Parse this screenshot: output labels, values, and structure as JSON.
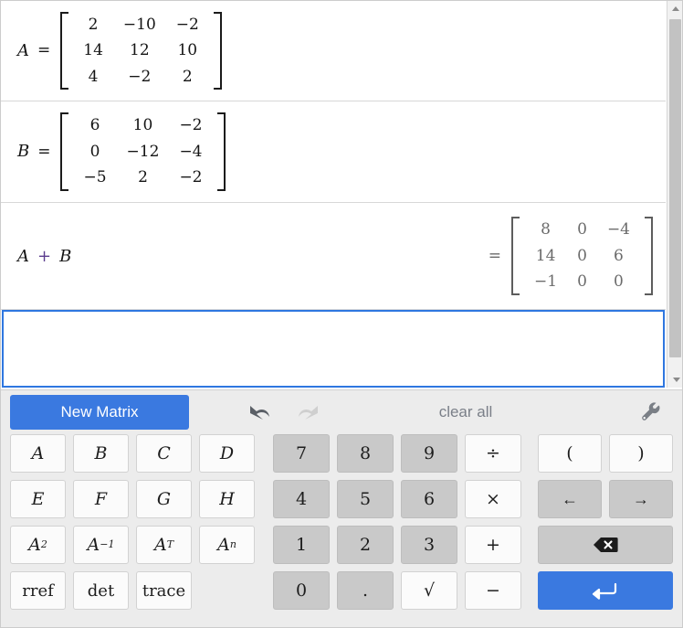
{
  "workspace": {
    "rows": [
      {
        "id": "row-a",
        "label": "A",
        "equals": "=",
        "matrix": [
          [
            "2",
            "−10",
            "−2"
          ],
          [
            "14",
            "12",
            "10"
          ],
          [
            "4",
            "−2",
            "2"
          ]
        ]
      },
      {
        "id": "row-b",
        "label": "B",
        "equals": "=",
        "matrix": [
          [
            "6",
            "10",
            "−2"
          ],
          [
            "0",
            "−12",
            "−4"
          ],
          [
            "−5",
            "2",
            "−2"
          ]
        ]
      }
    ],
    "result_row": {
      "expression_left": "A",
      "expression_op": "+",
      "expression_right": "B",
      "equals": "=",
      "matrix": [
        [
          "8",
          "0",
          "−4"
        ],
        [
          "14",
          "0",
          "6"
        ],
        [
          "−1",
          "0",
          "0"
        ]
      ]
    },
    "input_row": {
      "value": "",
      "placeholder": ""
    },
    "scrollbar": {
      "up_icon": "scroll-up-arrow",
      "down_icon": "scroll-down-arrow"
    }
  },
  "toolbar": {
    "new_matrix_label": "New Matrix",
    "undo_icon": "undo-arrow-icon",
    "redo_icon": "redo-arrow-icon",
    "clear_all_label": "clear all",
    "settings_icon": "wrench-icon"
  },
  "keypad": {
    "matrix_keys": [
      [
        "A",
        "B",
        "C",
        "D"
      ],
      [
        "E",
        "F",
        "G",
        "H"
      ]
    ],
    "power_keys": [
      {
        "base": "A",
        "sup": "2"
      },
      {
        "base": "A",
        "sup": "−1"
      },
      {
        "base": "A",
        "sup": "T"
      },
      {
        "base": "A",
        "sup": "n"
      }
    ],
    "function_keys": [
      "rref",
      "det",
      "trace"
    ],
    "number_rows": [
      [
        "7",
        "8",
        "9"
      ],
      [
        "4",
        "5",
        "6"
      ],
      [
        "1",
        "2",
        "3"
      ],
      [
        "0",
        "."
      ]
    ],
    "operator_keys": [
      "÷",
      "×",
      "+",
      "−"
    ],
    "sqrt_key": "√",
    "paren_keys": [
      "(",
      ")"
    ],
    "arrow_keys": [
      "←",
      "→"
    ],
    "backspace_icon": "backspace-icon",
    "enter_icon": "enter-return-icon"
  },
  "colors": {
    "accent_blue": "#3a79e0",
    "panel_gray": "#ececec",
    "digit_gray": "#c9c9c9",
    "result_text": "#6b6b6b"
  }
}
